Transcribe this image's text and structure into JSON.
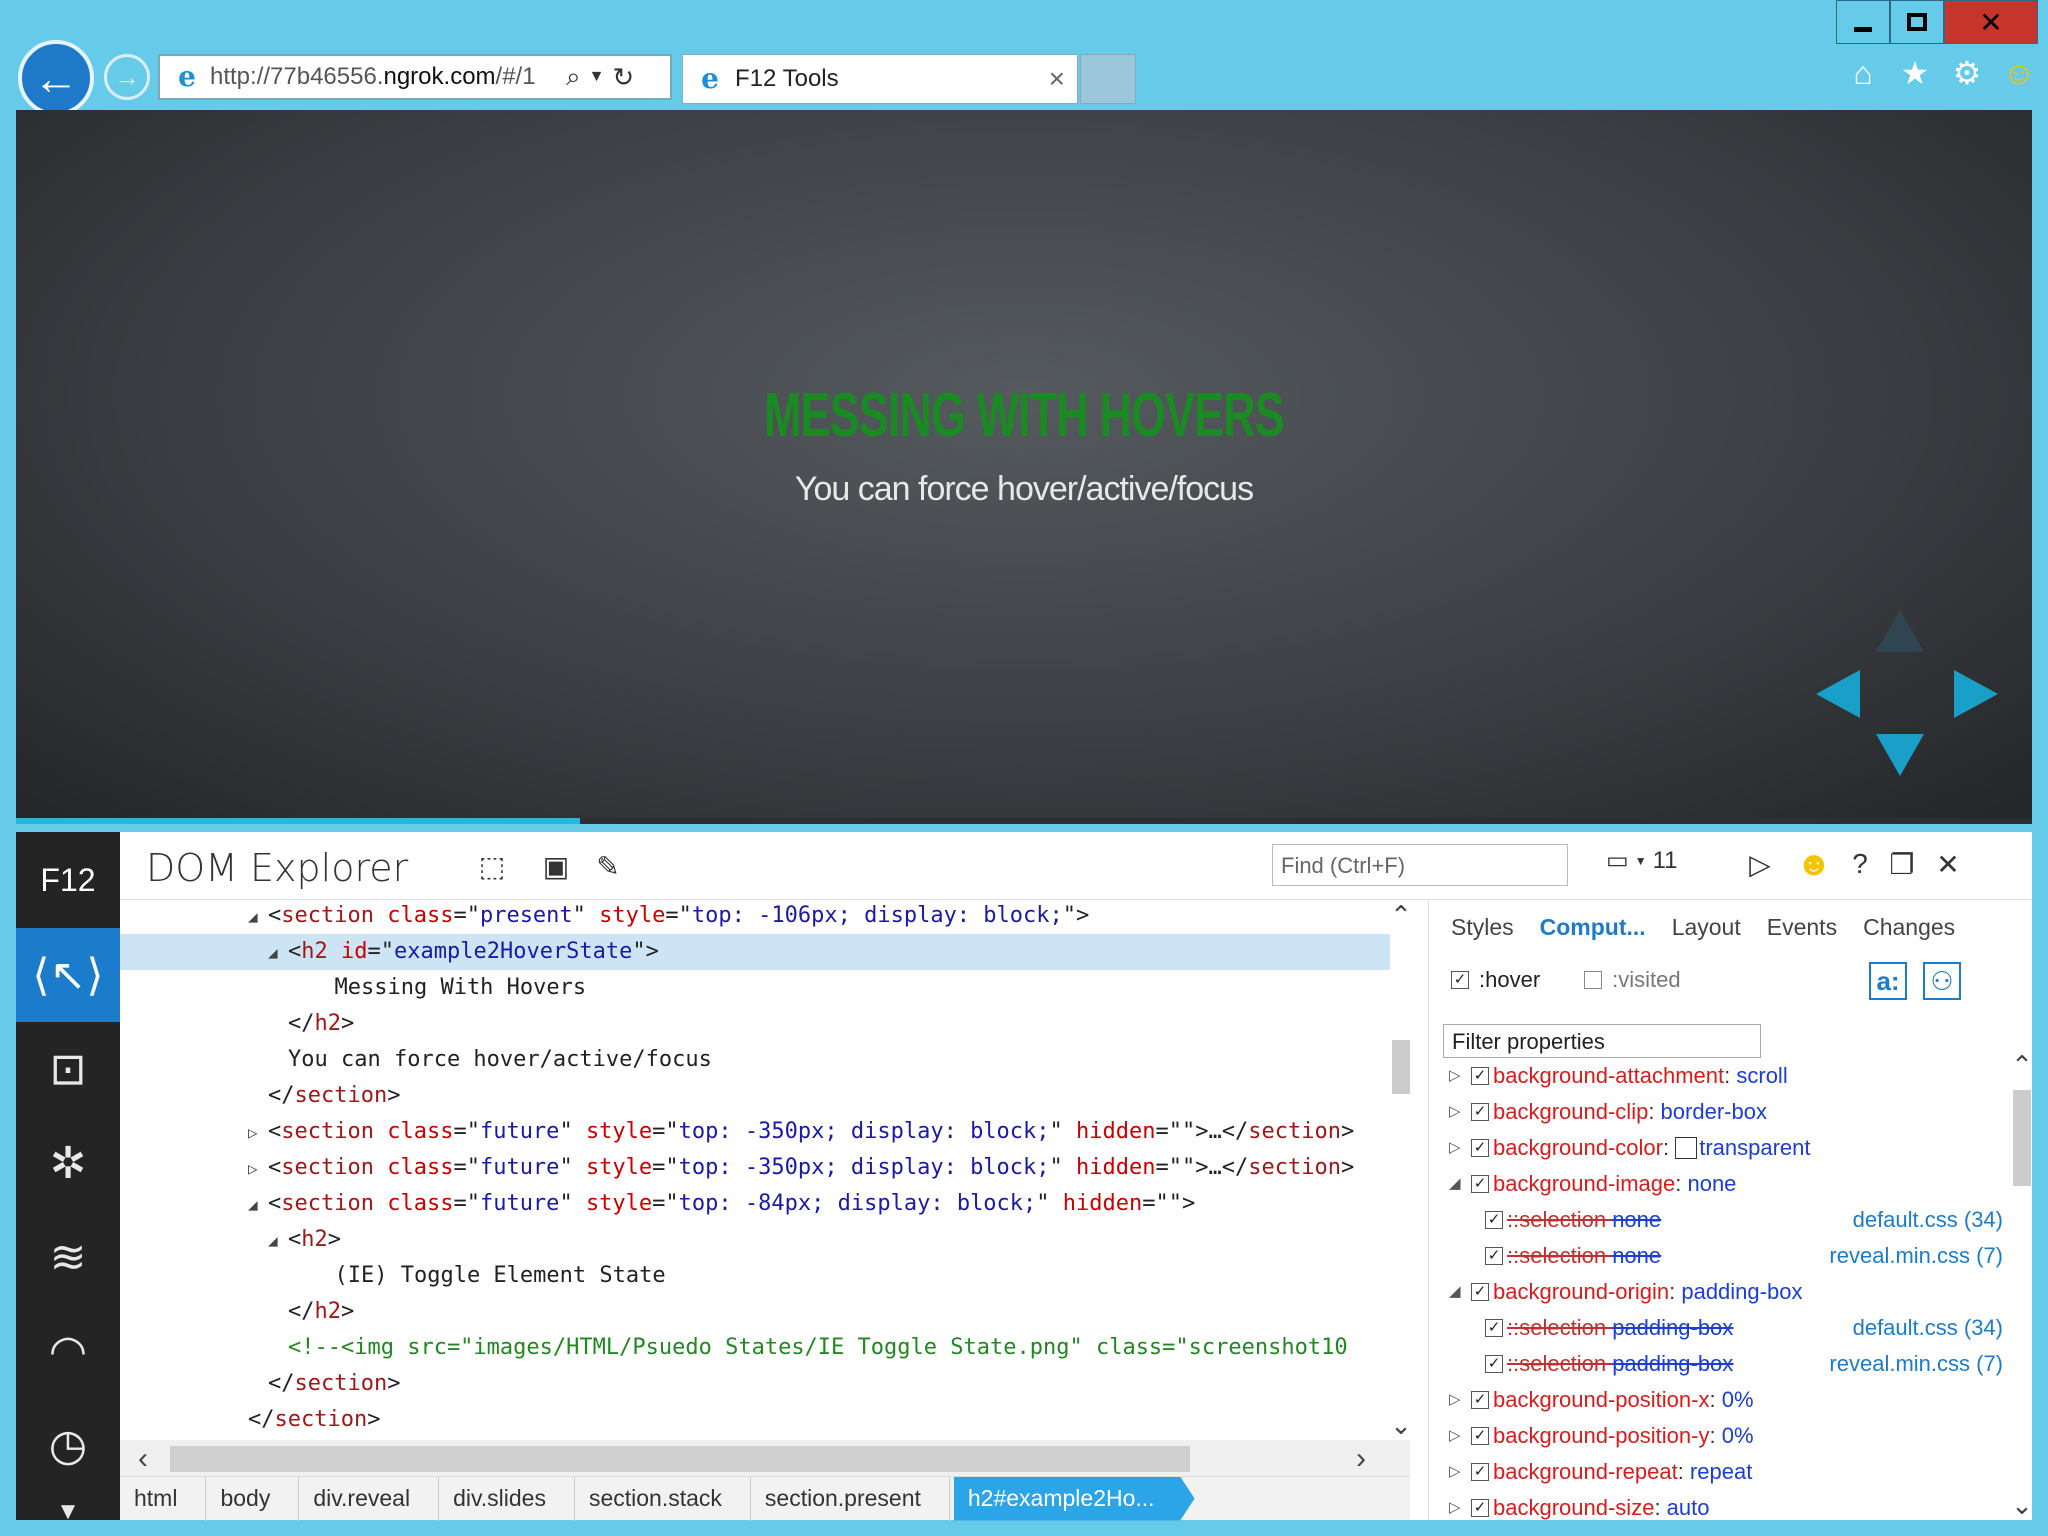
{
  "browser": {
    "address": {
      "url_prefix": "http://77b46556.",
      "url_domain": "ngrok.com",
      "url_suffix": "/#/1"
    },
    "tab": {
      "title": "F12 Tools"
    }
  },
  "slide": {
    "title": "MESSING WITH HOVERS",
    "subtitle": "You can force hover/active/focus",
    "progress": 0.28
  },
  "devtools": {
    "logo": "F12",
    "tool_title": "DOM Explorer",
    "find_placeholder": "Find (Ctrl+F)",
    "document_mode": "11",
    "dom_lines": [
      {
        "toggle": "◢",
        "parts": [
          [
            "t",
            "<"
          ],
          [
            "tag",
            "section"
          ],
          [
            "t",
            " "
          ],
          [
            "an",
            "class"
          ],
          [
            "t",
            "=\""
          ],
          [
            "av",
            "present"
          ],
          [
            "t",
            "\" "
          ],
          [
            "an",
            "style"
          ],
          [
            "t",
            "=\""
          ],
          [
            "av",
            "top: -106px; display: block;"
          ],
          [
            "t",
            "\">"
          ]
        ]
      },
      {
        "toggle": "◢",
        "sel": true,
        "parts": [
          [
            "t",
            "<"
          ],
          [
            "tag",
            "h2"
          ],
          [
            "t",
            " "
          ],
          [
            "an",
            "id"
          ],
          [
            "t",
            "=\""
          ],
          [
            "av",
            "example2HoverState"
          ],
          [
            "t",
            "\">"
          ]
        ]
      },
      {
        "toggle": "",
        "parts": [
          [
            "tx",
            "  Messing With Hovers"
          ]
        ]
      },
      {
        "toggle": "",
        "parts": [
          [
            "t",
            "</"
          ],
          [
            "tag",
            "h2"
          ],
          [
            "t",
            ">"
          ]
        ]
      },
      {
        "toggle": "",
        "parts": [
          [
            "tx",
            "You can force hover/active/focus"
          ]
        ]
      },
      {
        "toggle": "",
        "parts": [
          [
            "t",
            "</"
          ],
          [
            "tag",
            "section"
          ],
          [
            "t",
            ">"
          ]
        ]
      },
      {
        "toggle": "▷",
        "parts": [
          [
            "t",
            "<"
          ],
          [
            "tag",
            "section"
          ],
          [
            "t",
            " "
          ],
          [
            "an",
            "class"
          ],
          [
            "t",
            "=\""
          ],
          [
            "av",
            "future"
          ],
          [
            "t",
            "\" "
          ],
          [
            "an",
            "style"
          ],
          [
            "t",
            "=\""
          ],
          [
            "av",
            "top: -350px; display: block;"
          ],
          [
            "t",
            "\" "
          ],
          [
            "an",
            "hidden"
          ],
          [
            "t",
            "=\"\">…</"
          ],
          [
            "tag",
            "section"
          ],
          [
            "t",
            ">"
          ]
        ]
      },
      {
        "toggle": "▷",
        "parts": [
          [
            "t",
            "<"
          ],
          [
            "tag",
            "section"
          ],
          [
            "t",
            " "
          ],
          [
            "an",
            "class"
          ],
          [
            "t",
            "=\""
          ],
          [
            "av",
            "future"
          ],
          [
            "t",
            "\" "
          ],
          [
            "an",
            "style"
          ],
          [
            "t",
            "=\""
          ],
          [
            "av",
            "top: -350px; display: block;"
          ],
          [
            "t",
            "\" "
          ],
          [
            "an",
            "hidden"
          ],
          [
            "t",
            "=\"\">…</"
          ],
          [
            "tag",
            "section"
          ],
          [
            "t",
            ">"
          ]
        ]
      },
      {
        "toggle": "◢",
        "parts": [
          [
            "t",
            "<"
          ],
          [
            "tag",
            "section"
          ],
          [
            "t",
            " "
          ],
          [
            "an",
            "class"
          ],
          [
            "t",
            "=\""
          ],
          [
            "av",
            "future"
          ],
          [
            "t",
            "\" "
          ],
          [
            "an",
            "style"
          ],
          [
            "t",
            "=\""
          ],
          [
            "av",
            "top: -84px; display: block;"
          ],
          [
            "t",
            "\" "
          ],
          [
            "an",
            "hidden"
          ],
          [
            "t",
            "=\"\">"
          ]
        ]
      },
      {
        "toggle": "◢",
        "parts": [
          [
            "t",
            "<"
          ],
          [
            "tag",
            "h2"
          ],
          [
            "t",
            ">"
          ]
        ]
      },
      {
        "toggle": "",
        "parts": [
          [
            "tx",
            "  (IE) Toggle Element State"
          ]
        ]
      },
      {
        "toggle": "",
        "parts": [
          [
            "t",
            "</"
          ],
          [
            "tag",
            "h2"
          ],
          [
            "t",
            ">"
          ]
        ]
      },
      {
        "toggle": "",
        "parts": [
          [
            "cm",
            "<!--<img src=\"images/HTML/Psuedo States/IE Toggle State.png\" class=\"screenshot10"
          ]
        ]
      },
      {
        "toggle": "",
        "parts": [
          [
            "t",
            "</"
          ],
          [
            "tag",
            "section"
          ],
          [
            "t",
            ">"
          ]
        ]
      },
      {
        "toggle": "",
        "parts": [
          [
            "t",
            "</"
          ],
          [
            "tag",
            "section"
          ],
          [
            "t",
            ">"
          ]
        ]
      }
    ],
    "breadcrumb": [
      "html",
      "body",
      "div.reveal",
      "div.slides",
      "section.stack",
      "section.present",
      "h2#example2Ho..."
    ],
    "pane": {
      "tabs": [
        "Styles",
        "Comput...",
        "Layout",
        "Events",
        "Changes"
      ],
      "active_tab": 1,
      "state_hover": ":hover",
      "state_visited": ":visited",
      "filter_placeholder": "Filter properties",
      "properties": [
        {
          "kind": "prop",
          "toggle": "▷",
          "name": "background-attachment",
          "value": "scroll"
        },
        {
          "kind": "prop",
          "toggle": "▷",
          "name": "background-clip",
          "value": "border-box"
        },
        {
          "kind": "prop",
          "toggle": "▷",
          "name": "background-color",
          "value": "transparent",
          "swatch": true
        },
        {
          "kind": "prop",
          "toggle": "◢",
          "name": "background-image",
          "value": "none"
        },
        {
          "kind": "sub",
          "name": "::selection",
          "value": "none",
          "source": "default.css (34)"
        },
        {
          "kind": "sub",
          "name": "::selection",
          "value": "none",
          "source": "reveal.min.css (7)"
        },
        {
          "kind": "prop",
          "toggle": "◢",
          "name": "background-origin",
          "value": "padding-box"
        },
        {
          "kind": "sub",
          "name": "::selection",
          "value": "padding-box",
          "source": "default.css (34)"
        },
        {
          "kind": "sub",
          "name": "::selection",
          "value": "padding-box",
          "source": "reveal.min.css (7)"
        },
        {
          "kind": "prop",
          "toggle": "▷",
          "name": "background-position-x",
          "value": "0%"
        },
        {
          "kind": "prop",
          "toggle": "▷",
          "name": "background-position-y",
          "value": "0%"
        },
        {
          "kind": "prop",
          "toggle": "▷",
          "name": "background-repeat",
          "value": "repeat"
        },
        {
          "kind": "prop",
          "toggle": "▷",
          "name": "background-size",
          "value": "auto"
        }
      ]
    }
  }
}
